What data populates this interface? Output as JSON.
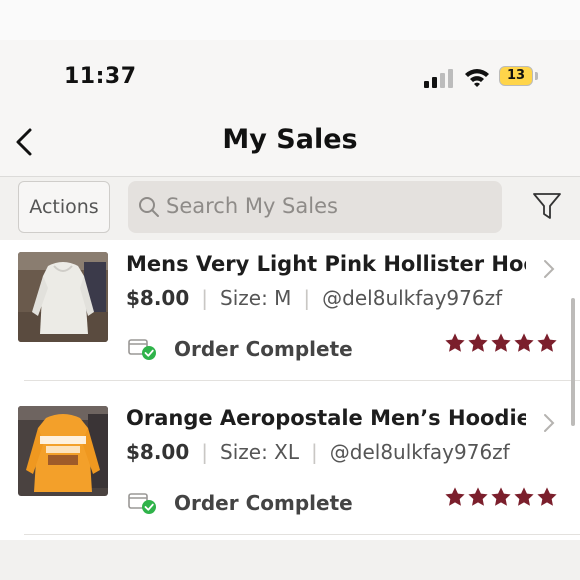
{
  "status_bar": {
    "time": "11:37",
    "battery": "13"
  },
  "nav": {
    "title": "My Sales"
  },
  "toolbar": {
    "actions_label": "Actions",
    "search_placeholder": "Search My Sales"
  },
  "items": [
    {
      "title": "Mens Very Light Pink Hollister Hoodi…",
      "price": "$8.00",
      "size": "Size: M",
      "seller": "@del8ulkfay976zf",
      "status": "Order Complete",
      "rating": 5
    },
    {
      "title": "Orange Aeropostale Men’s Hoodie Si…",
      "price": "$8.00",
      "size": "Size: XL",
      "seller": "@del8ulkfay976zf",
      "status": "Order Complete",
      "rating": 5
    }
  ],
  "colors": {
    "star": "#7b1f2c",
    "check": "#2fb34a",
    "battery": "#ffd54a"
  }
}
